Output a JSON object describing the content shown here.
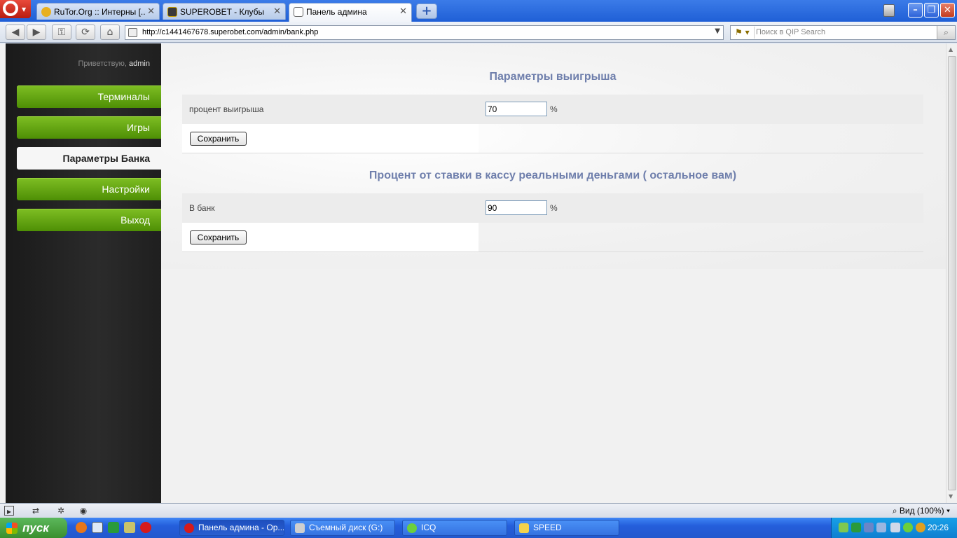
{
  "browser": {
    "tabs": [
      {
        "label": "RuTor.Org :: Интерны [..."
      },
      {
        "label": "SUPEROBET - Клубы"
      },
      {
        "label": "Панель админа"
      }
    ],
    "url": "http://c1441467678.superobet.com/admin/bank.php",
    "search_placeholder": "Поиск в QIP Search",
    "zoom_label": "Вид (100%)"
  },
  "sidebar": {
    "greeting_prefix": "Приветствую, ",
    "username": "admin",
    "items": [
      {
        "label": "Терминалы"
      },
      {
        "label": "Игры"
      },
      {
        "label": "Параметры Банка"
      },
      {
        "label": "Настройки"
      },
      {
        "label": "Выход"
      }
    ]
  },
  "main": {
    "section1": {
      "title": "Параметры выигрыша",
      "label": "процент выигрыша",
      "value": "70",
      "unit": "%",
      "save_label": "Сохранить"
    },
    "section2": {
      "title": "Процент от ставки в кассу реальными деньгами ( остальное вам)",
      "label": "В банк",
      "value": "90",
      "unit": "%",
      "save_label": "Сохранить"
    }
  },
  "taskbar": {
    "start_label": "пуск",
    "tasks": [
      {
        "label": "Панель админа - Op..."
      },
      {
        "label": "Съемный диск (G:)"
      },
      {
        "label": "ICQ"
      },
      {
        "label": "SPEED"
      }
    ],
    "clock": "20:26"
  },
  "colors": {
    "menu_green": "#6aaa15",
    "section_title": "#6f7fac",
    "sidebar_dark": "#222222"
  }
}
